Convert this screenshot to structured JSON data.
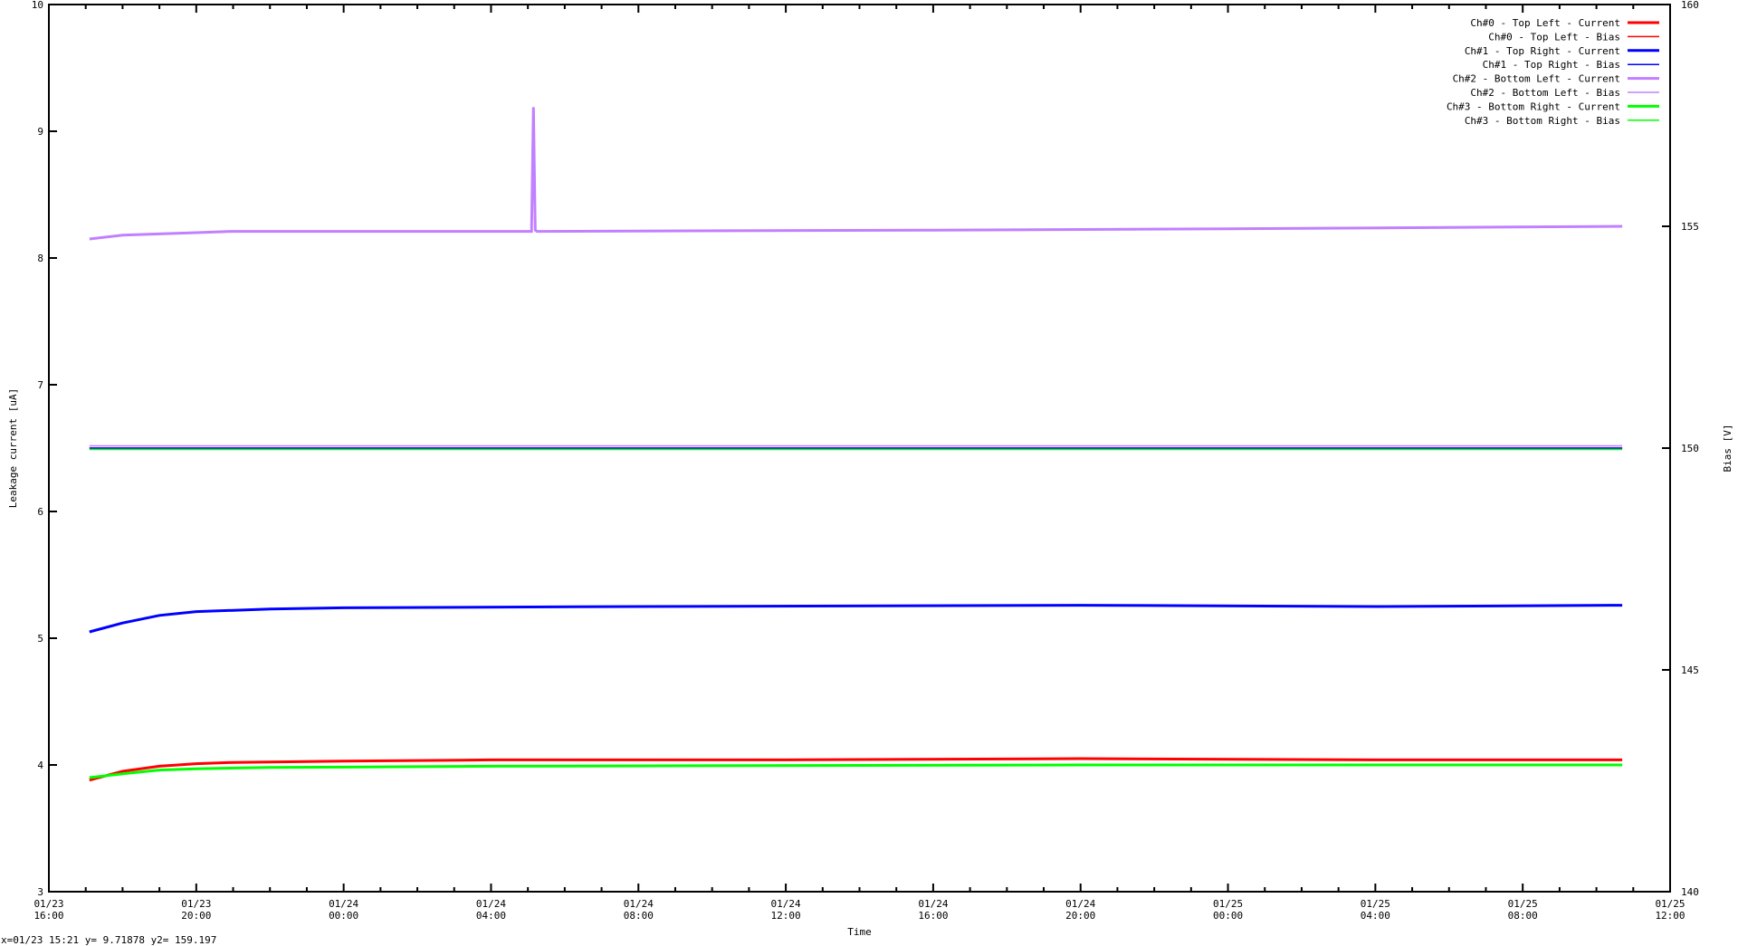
{
  "chart_data": {
    "type": "line",
    "xlabel": "Time",
    "ylabel": "Leakage current [uA]",
    "y2label": "Bias [V]",
    "x_unit": "hours since 01/23 16:00",
    "xlim": [
      0,
      44
    ],
    "ylim": [
      3,
      10
    ],
    "y2lim": [
      140,
      160
    ],
    "x_ticks": [
      {
        "h": 0,
        "l1": "01/23",
        "l2": "16:00"
      },
      {
        "h": 4,
        "l1": "01/23",
        "l2": "20:00"
      },
      {
        "h": 8,
        "l1": "01/24",
        "l2": "00:00"
      },
      {
        "h": 12,
        "l1": "01/24",
        "l2": "04:00"
      },
      {
        "h": 16,
        "l1": "01/24",
        "l2": "08:00"
      },
      {
        "h": 20,
        "l1": "01/24",
        "l2": "12:00"
      },
      {
        "h": 24,
        "l1": "01/24",
        "l2": "16:00"
      },
      {
        "h": 28,
        "l1": "01/24",
        "l2": "20:00"
      },
      {
        "h": 32,
        "l1": "01/25",
        "l2": "00:00"
      },
      {
        "h": 36,
        "l1": "01/25",
        "l2": "04:00"
      },
      {
        "h": 40,
        "l1": "01/25",
        "l2": "08:00"
      },
      {
        "h": 44,
        "l1": "01/25",
        "l2": "12:00"
      }
    ],
    "y_ticks": [
      "3",
      "4",
      "5",
      "6",
      "7",
      "8",
      "9",
      "10"
    ],
    "y2_ticks": [
      "140",
      "145",
      "150",
      "155",
      "160"
    ],
    "legend_position": "top-right",
    "series": [
      {
        "name": "Ch#0 - Top Left - Current",
        "axis": "y",
        "color": "#ff0000",
        "width": 3,
        "points": [
          [
            1.1,
            3.88
          ],
          [
            2,
            3.95
          ],
          [
            3,
            3.99
          ],
          [
            4,
            4.01
          ],
          [
            5,
            4.02
          ],
          [
            8,
            4.03
          ],
          [
            12,
            4.04
          ],
          [
            20,
            4.04
          ],
          [
            28,
            4.05
          ],
          [
            36,
            4.04
          ],
          [
            42.7,
            4.04
          ]
        ]
      },
      {
        "name": "Ch#0 - Top Left - Bias",
        "axis": "y2",
        "color": "#ff0000",
        "width": 1.5,
        "points": [
          [
            1.1,
            150.0
          ],
          [
            42.7,
            150.0
          ]
        ]
      },
      {
        "name": "Ch#1 - Top Right - Current",
        "axis": "y",
        "color": "#0000ff",
        "width": 3,
        "points": [
          [
            1.1,
            5.05
          ],
          [
            2,
            5.12
          ],
          [
            3,
            5.18
          ],
          [
            4,
            5.21
          ],
          [
            5,
            5.22
          ],
          [
            6,
            5.23
          ],
          [
            8,
            5.24
          ],
          [
            16,
            5.25
          ],
          [
            28,
            5.26
          ],
          [
            36,
            5.25
          ],
          [
            42.7,
            5.26
          ]
        ]
      },
      {
        "name": "Ch#1 - Top Right - Bias",
        "axis": "y2",
        "color": "#0000ff",
        "width": 1.5,
        "points": [
          [
            1.1,
            150.0
          ],
          [
            42.7,
            150.0
          ]
        ]
      },
      {
        "name": "Ch#2 - Bottom Left - Current",
        "axis": "y",
        "color": "#c080ff",
        "width": 3,
        "points": [
          [
            1.1,
            8.15
          ],
          [
            2,
            8.18
          ],
          [
            4,
            8.2
          ],
          [
            5,
            8.21
          ],
          [
            13.1,
            8.21
          ],
          [
            13.15,
            9.19
          ],
          [
            13.2,
            8.22
          ],
          [
            13.25,
            8.21
          ],
          [
            24,
            8.22
          ],
          [
            32,
            8.23
          ],
          [
            42.7,
            8.25
          ]
        ]
      },
      {
        "name": "Ch#2 - Bottom Left - Bias",
        "axis": "y2",
        "color": "#c080ff",
        "width": 1.5,
        "points": [
          [
            1.1,
            150.05
          ],
          [
            42.7,
            150.05
          ]
        ]
      },
      {
        "name": "Ch#3 - Bottom Right - Current",
        "axis": "y",
        "color": "#00ff00",
        "width": 3,
        "points": [
          [
            1.1,
            3.9
          ],
          [
            2,
            3.93
          ],
          [
            3,
            3.96
          ],
          [
            4,
            3.97
          ],
          [
            6,
            3.98
          ],
          [
            12,
            3.99
          ],
          [
            28,
            4.0
          ],
          [
            42.7,
            4.0
          ]
        ]
      },
      {
        "name": "Ch#3 - Bottom Right - Bias",
        "axis": "y2",
        "color": "#00ff00",
        "width": 1.5,
        "points": [
          [
            1.1,
            149.97
          ],
          [
            42.7,
            149.97
          ]
        ]
      }
    ]
  },
  "status": "x=01/23 15:21 y= 9.71878 y2= 159.197"
}
